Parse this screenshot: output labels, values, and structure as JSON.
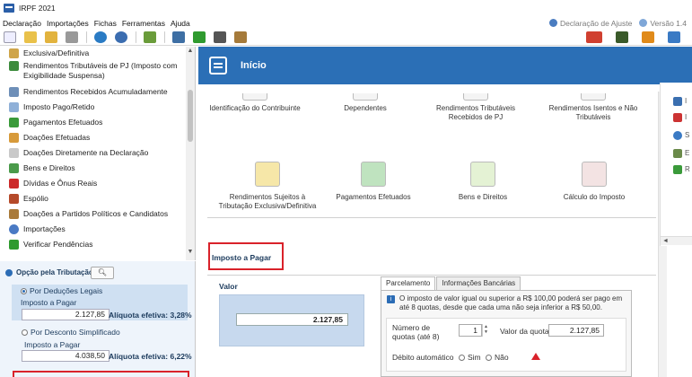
{
  "window": {
    "title": "IRPF 2021"
  },
  "menu": {
    "items": [
      "Declaração",
      "Importações",
      "Fichas",
      "Ferramentas",
      "Ajuda"
    ],
    "declaracao_ajuste": "Declaração de Ajuste",
    "versao": "Versão 1.4"
  },
  "sidebar": {
    "items": [
      {
        "label": "Exclusiva/Definitiva",
        "icon": "document-icon"
      },
      {
        "label": "Rendimentos Tributáveis de PJ (Imposto com Exigibilidade Suspensa)",
        "icon": "money-icon"
      },
      {
        "label": "Rendimentos Recebidos Acumuladamente",
        "icon": "calendar-icon"
      },
      {
        "label": "Imposto Pago/Retido",
        "icon": "search-doc-icon"
      },
      {
        "label": "Pagamentos Efetuados",
        "icon": "cash-icon"
      },
      {
        "label": "Doações Efetuadas",
        "icon": "gift-icon"
      },
      {
        "label": "Doações Diretamente na Declaração",
        "icon": "doc-icon"
      },
      {
        "label": "Bens e Direitos",
        "icon": "dollar-doc-icon"
      },
      {
        "label": "Dívidas e Ônus Reais",
        "icon": "down-arrow-icon"
      },
      {
        "label": "Espólio",
        "icon": "book-icon"
      },
      {
        "label": "Doações a Partidos Políticos e Candidatos",
        "icon": "party-icon"
      },
      {
        "label": "Importações",
        "icon": "globe-icon"
      },
      {
        "label": "Verificar Pendências",
        "icon": "check-icon"
      }
    ]
  },
  "tax_option": {
    "header": "Opção pela Tributação:",
    "legal": {
      "label": "Por Deduções Legais",
      "imposto_label": "Imposto a Pagar",
      "value": "2.127,85",
      "aliquota": "Alíquota efetiva: 3,28%"
    },
    "simplificado": {
      "label": "Por Desconto Simplificado",
      "imposto_label": "Imposto a Pagar",
      "value": "4.038,50",
      "aliquota": "Alíquota efetiva: 6,22%"
    }
  },
  "main": {
    "title": "Início",
    "cards_row1": [
      "Identificação do Contribuinte",
      "Dependentes",
      "Rendimentos Tributáveis Recebidos de PJ",
      "Rendimentos Isentos e Não Tributáveis"
    ],
    "cards_row2": [
      "Rendimentos Sujeitos à Tributação Exclusiva/Definitiva",
      "Pagamentos Efetuados",
      "Bens e Direitos",
      "Cálculo do Imposto"
    ],
    "section_title": "Imposto a Pagar",
    "valor_label": "Valor",
    "valor": "2.127,85",
    "tabs": [
      "Parcelamento",
      "Informações Bancárias"
    ],
    "info": "O imposto de valor igual ou superior a R$ 100,00 poderá ser pago em até 8 quotas, desde que cada uma não seja inferior a R$ 50,00.",
    "form": {
      "num_quotas_label": "Número de quotas (até 8)",
      "num_quotas_value": "1",
      "valor_quota_label": "Valor da quota",
      "valor_quota_value": "2.127,85",
      "debito_label": "Débito automático",
      "sim": "Sim",
      "nao": "Não"
    }
  },
  "colors": {
    "header_blue": "#2b6fb6",
    "highlight_red": "#d9222a",
    "panel_blue": "#cfe0f2"
  }
}
